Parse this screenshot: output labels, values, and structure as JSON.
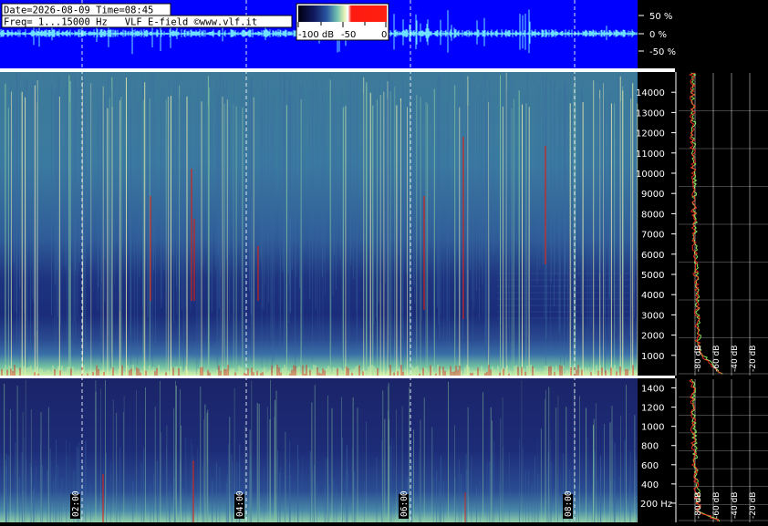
{
  "header": {
    "date_time": "Date=2026-08-09 Time=08:45",
    "freq_info": "Freq= 1...15000 Hz   VLF E-field ©www.vlf.it"
  },
  "color_scale": {
    "labels": [
      "-100 dB",
      "-50",
      "0"
    ]
  },
  "waveform": {
    "amplitude_labels": [
      "50 %",
      "0 %",
      "-50 %"
    ],
    "background_color": "#0000ff",
    "trace_color": "#6fe0ff"
  },
  "spectrogram_upper": {
    "freq_labels": [
      "14000",
      "13000",
      "12000",
      "11000",
      "10000",
      "9000",
      "8000",
      "7000",
      "6000",
      "5000",
      "4000",
      "3000",
      "2000",
      "1000"
    ],
    "spectrum_db_labels": [
      "-80 dB",
      "-60 dB",
      "-40 dB",
      "-20 dB"
    ]
  },
  "spectrogram_lower": {
    "freq_labels": [
      "1400",
      "1200",
      "1000",
      "800",
      "600",
      "400",
      "200 Hz"
    ],
    "spectrum_db_labels": [
      "-80 dB",
      "-60 dB",
      "-40 dB",
      "-20 dB"
    ]
  },
  "time_axis": {
    "labels": [
      "02:00",
      "04:00",
      "06:00",
      "08:00"
    ]
  },
  "colors": {
    "background": "#000000",
    "spectro_base": "#1a2a6e",
    "spectro_mid": "#3a6aa0",
    "spectro_high": "#8fd0a0",
    "spectro_peak": "#ffffb0",
    "hot": "#e02010",
    "grid": "#ffffff"
  }
}
